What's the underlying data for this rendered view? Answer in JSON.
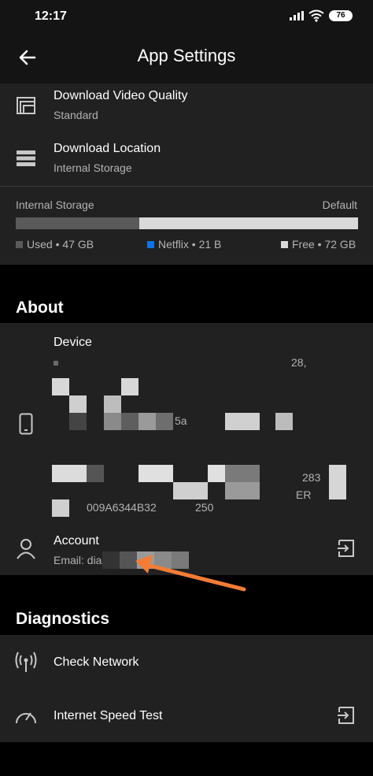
{
  "status_bar": {
    "time": "12:17",
    "battery": "76"
  },
  "header": {
    "title": "App Settings"
  },
  "download": {
    "quality_title": "Download Video Quality",
    "quality_value": "Standard",
    "location_title": "Download Location",
    "location_value": "Internal Storage"
  },
  "storage": {
    "label": "Internal Storage",
    "default_label": "Default",
    "used_fraction": 0.36,
    "legend": [
      {
        "label": "Used • 47 GB",
        "color": "#5a5a5a"
      },
      {
        "label": "Netflix • 21 B",
        "color": "#0a74e8"
      },
      {
        "label": "Free • 72 GB",
        "color": "#d9d9d9"
      }
    ]
  },
  "about": {
    "heading": "About",
    "device_title": "Device",
    "device_lines": [
      "28,",
      "5a",
      "283",
      "ER",
      "009A6344B32",
      "250"
    ],
    "account_title": "Account",
    "account_email_prefix": "Email: dia"
  },
  "diagnostics": {
    "heading": "Diagnostics",
    "check_network": "Check Network",
    "speed_test": "Internet Speed Test"
  },
  "colors": {
    "accent_arrow": "#f47c36",
    "background": "#000000",
    "panel": "#212121"
  }
}
